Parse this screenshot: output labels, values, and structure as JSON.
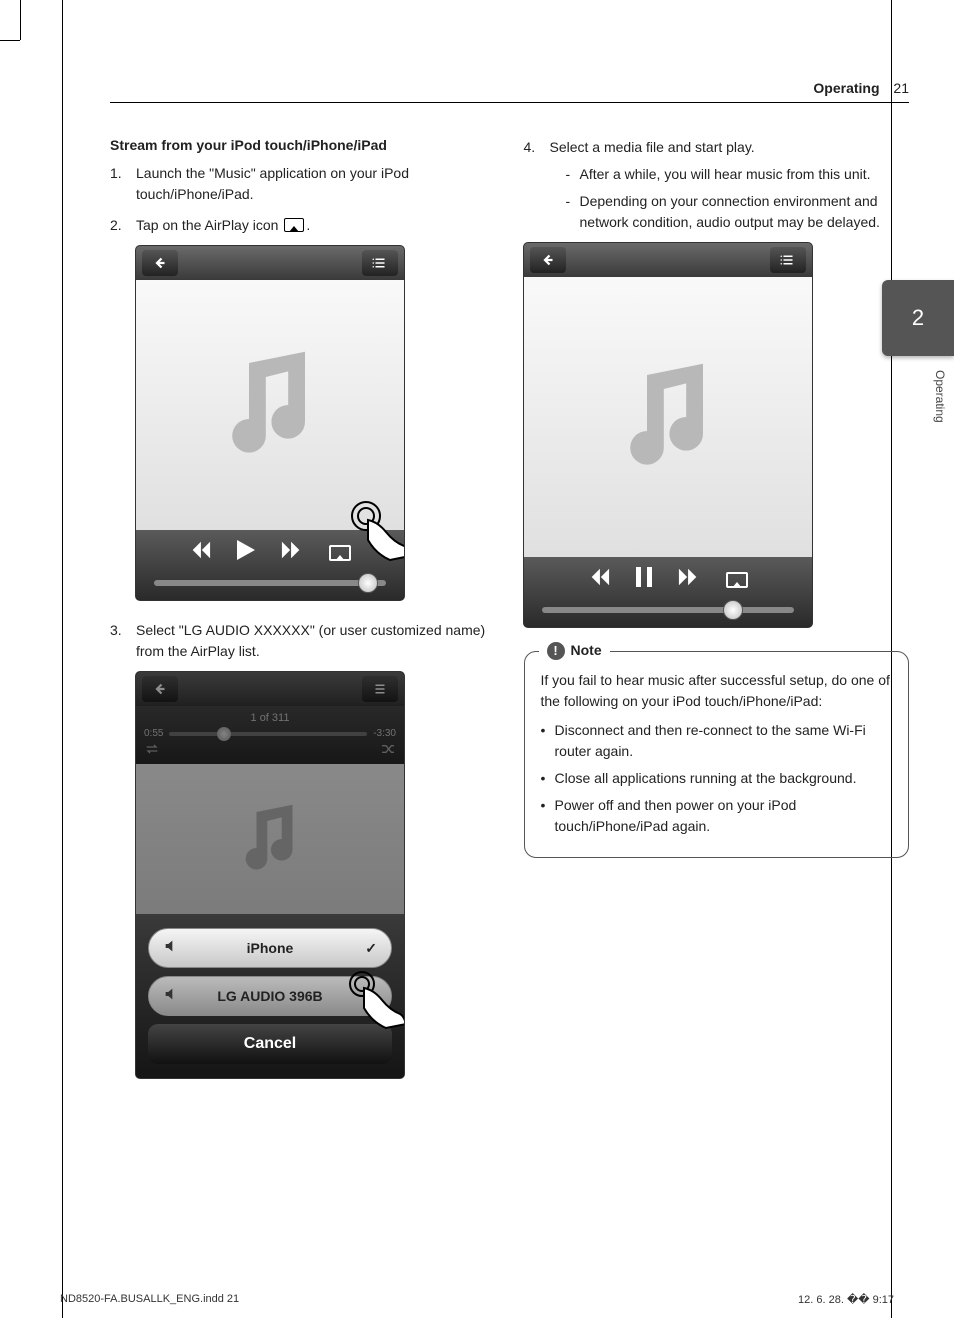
{
  "header": {
    "section": "Operating",
    "page_number": "21"
  },
  "side_tab": {
    "number": "2",
    "label": "Operating"
  },
  "left_col": {
    "subhead": "Stream from your iPod touch/iPhone/iPad",
    "step1": "Launch the \"Music\" application on your iPod touch/iPhone/iPad.",
    "step2_pre": "Tap on the AirPlay icon",
    "step2_post": ".",
    "step3": "Select \"LG AUDIO XXXXXX\" (or user customized name) from the AirPlay list."
  },
  "right_col": {
    "step4": "Select a media file and start play.",
    "step4_sub1": "After a while, you will hear music from this unit.",
    "step4_sub2": "Depending on your connection environment and network condition, audio output may be delayed."
  },
  "menu_phone": {
    "track_index": "1  of 311",
    "elapsed": "0:55",
    "remaining": "-3:30",
    "option_iphone": "iPhone",
    "option_lg": "LG AUDIO 396B",
    "cancel": "Cancel"
  },
  "note": {
    "title": "Note",
    "intro": "If you fail to hear music after successful setup, do one of the following on your iPod touch/iPhone/iPad:",
    "b1": "Disconnect and then re-connect to the same Wi-Fi router again.",
    "b2": "Close all applications running at the background.",
    "b3": "Power off and then power on your iPod touch/iPhone/iPad again."
  },
  "footer": {
    "left": "ND8520-FA.BUSALLK_ENG.indd   21",
    "right": "12. 6. 28.   �� 9:17"
  }
}
